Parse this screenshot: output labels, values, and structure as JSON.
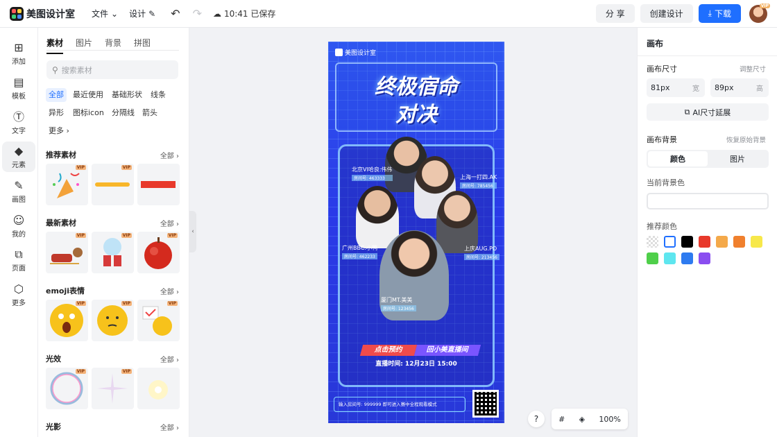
{
  "app": {
    "name": "美图设计室"
  },
  "topbar": {
    "menu_file": "文件",
    "menu_design": "设计",
    "saved_status": "10:41 已保存",
    "share": "分 享",
    "create": "创建设计",
    "download": "下载",
    "avatar_badge": "VIP"
  },
  "rail": [
    {
      "label": "添加",
      "icon": "plus-square-icon"
    },
    {
      "label": "模板",
      "icon": "template-icon"
    },
    {
      "label": "文字",
      "icon": "text-icon"
    },
    {
      "label": "元素",
      "icon": "shapes-icon"
    },
    {
      "label": "画图",
      "icon": "draw-icon"
    },
    {
      "label": "我的",
      "icon": "user-icon"
    },
    {
      "label": "页面",
      "icon": "pages-icon"
    },
    {
      "label": "更多",
      "icon": "cube-icon"
    }
  ],
  "panel": {
    "tabs": [
      "素材",
      "图片",
      "背景",
      "拼图"
    ],
    "search_placeholder": "搜索素材",
    "chips": [
      "全部",
      "最近使用",
      "基础形状",
      "线条",
      "异形",
      "图标icon",
      "分隔线",
      "箭头",
      "更多"
    ],
    "sections": [
      {
        "title": "推荐素材",
        "all": "全部"
      },
      {
        "title": "最新素材",
        "all": "全部"
      },
      {
        "title": "emoji表情",
        "all": "全部"
      },
      {
        "title": "光效",
        "all": "全部"
      },
      {
        "title": "光影",
        "all": "全部"
      }
    ],
    "vip": "VIP"
  },
  "poster": {
    "brand": "美图设计室",
    "title_line1": "终极宿命",
    "title_line2": "对决",
    "players": [
      {
        "name": "北京VI哈良:伟伟",
        "id": "房间号: 463333"
      },
      {
        "name": "上海一打四.AK",
        "id": "房间号: 785456"
      },
      {
        "name": "广州BBC.小鸭",
        "id": "房间号: 462233"
      },
      {
        "name": "上庆AUG.PO",
        "id": "房间号: 213456"
      },
      {
        "name": "厦门MT.美美",
        "id": "房间号: 123456"
      }
    ],
    "cta_a": "点击预约",
    "cta_b": "回小美直播间",
    "live_time": "直播时间: 12月23日 15:00",
    "bottom_text": "输入房间号: 999999 即可进入赛中全程观看模式"
  },
  "canvas_controls": {
    "help": "?",
    "zoom": "100%"
  },
  "right": {
    "title": "画布",
    "size_label": "画布尺寸",
    "size_link": "调整尺寸",
    "width_value": "81px",
    "width_unit": "宽",
    "height_value": "89px",
    "height_unit": "高",
    "ai_button": "AI尺寸延展",
    "bg_label": "画布背景",
    "bg_link": "恢复原始背景",
    "seg_color": "颜色",
    "seg_image": "图片",
    "current_bg": "当前背景色",
    "recommend": "推荐颜色",
    "swatches": [
      "transparent",
      "#ffffff",
      "#000000",
      "#e8392b",
      "#f4a94a",
      "#f0802e",
      "#f7e84a",
      "#4fcf4a",
      "#5ee6ef",
      "#2e7bf0",
      "#8a4ef0"
    ]
  }
}
